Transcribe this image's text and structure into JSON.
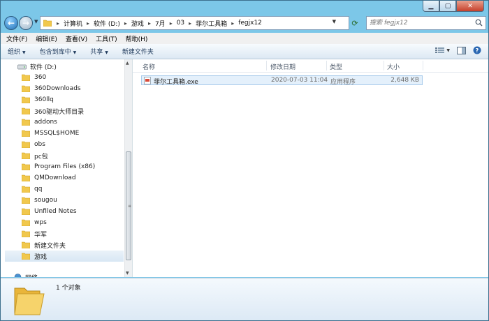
{
  "address": {
    "crumbs": [
      "计算机",
      "软件 (D:)",
      "游戏",
      "7月",
      "03",
      "菲尔工具箱",
      "fegjx12"
    ]
  },
  "search": {
    "placeholder": "搜索 fegjx12"
  },
  "menu": [
    "文件(F)",
    "编辑(E)",
    "查看(V)",
    "工具(T)",
    "帮助(H)"
  ],
  "commands": [
    {
      "label": "组织",
      "dropdown": true
    },
    {
      "label": "包含到库中",
      "dropdown": true
    },
    {
      "label": "共享",
      "dropdown": true
    },
    {
      "label": "新建文件夹",
      "dropdown": false
    }
  ],
  "tree": {
    "drive": "软件 (D:)",
    "items": [
      "360",
      "360Downloads",
      "360llq",
      "360驱动大师目录",
      "addons",
      "MSSQL$HOME",
      "obs",
      "pc包",
      "Program Files (x86)",
      "QMDownload",
      "qq",
      "sougou",
      "Unfiled Notes",
      "wps",
      "华军",
      "新建文件夹",
      "游戏"
    ],
    "selected": "游戏",
    "network": "网络"
  },
  "columns": {
    "name": "名称",
    "modified": "修改日期",
    "type": "类型",
    "size": "大小"
  },
  "files": [
    {
      "name": "菲尔工具箱.exe",
      "modified": "2020-07-03 11:04",
      "type": "应用程序",
      "size": "2,648 KB"
    }
  ],
  "status": {
    "count": "1 个对象"
  },
  "colors": {
    "frame": "#7cc7e8",
    "selection": "#e4f0fb",
    "folder": "#f1c84d"
  }
}
